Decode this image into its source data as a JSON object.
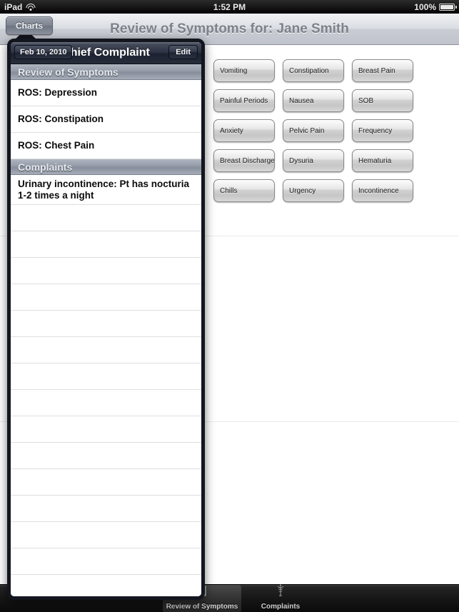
{
  "statusbar": {
    "device": "iPad",
    "wifi_icon": "wifi-icon",
    "time": "1:52 PM",
    "battery_percent": "100%",
    "battery_icon": "battery-icon"
  },
  "navbar": {
    "back_button": "Charts",
    "title": "Review of Symptoms for: Jane Smith"
  },
  "symptom_buttons": [
    [
      "Vomiting",
      "Constipation",
      "Breast Pain"
    ],
    [
      "Painful Periods",
      "Nausea",
      "SOB"
    ],
    [
      "Anxiety",
      "Pelvic Pain",
      "Frequency"
    ],
    [
      "Breast Discharge",
      "Dysuria",
      "Hematuria"
    ],
    [
      "Chills",
      "Urgency",
      "Incontinence"
    ]
  ],
  "popover": {
    "date_button": "Feb 10, 2010",
    "title": "Chief Complaint",
    "edit_button": "Edit",
    "sections": [
      {
        "header": "Review of Symptoms",
        "rows": [
          "ROS: Depression",
          "ROS: Constipation",
          "ROS: Chest Pain"
        ]
      },
      {
        "header": "Complaints",
        "rows": [
          "Urinary incontinence: Pt has nocturia 1-2 times a night"
        ]
      }
    ],
    "empty_row_count": 15
  },
  "tabbar": {
    "tabs": [
      {
        "label": "Review of Symptoms",
        "icon": "clipboard-icon",
        "selected": true
      },
      {
        "label": "Complaints",
        "icon": "caduceus-icon",
        "selected": false
      }
    ]
  },
  "colors": {
    "nav_title": "#7d818a",
    "popover_border": "#13151f",
    "section_header": "#949ba7",
    "content_bg": "#ffffff"
  }
}
